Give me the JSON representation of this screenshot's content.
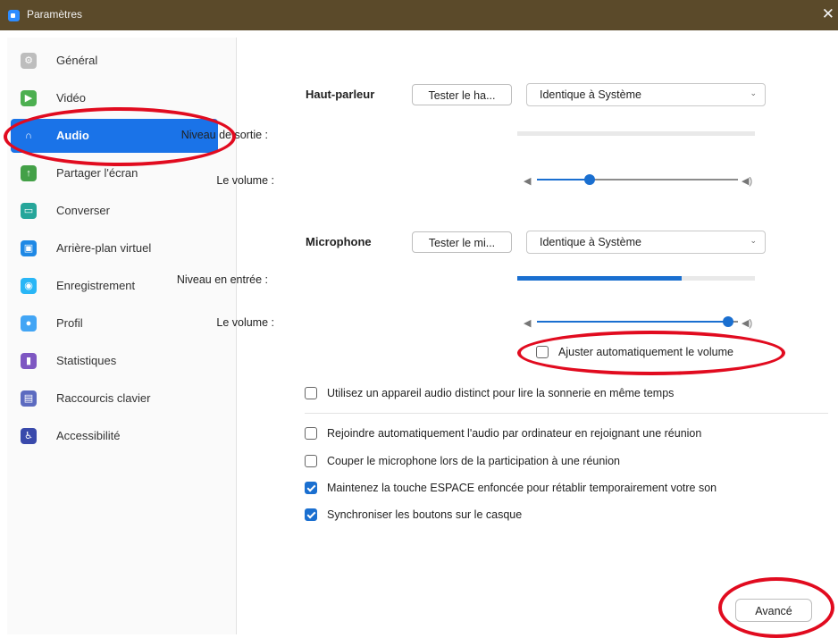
{
  "window": {
    "title": "Paramètres",
    "close_glyph": "✕"
  },
  "sidebar": {
    "items": [
      {
        "label": "Général",
        "icon": "gear-icon",
        "color": "#bdbdbd",
        "glyph": "⚙"
      },
      {
        "label": "Vidéo",
        "icon": "video-camera-icon",
        "color": "#4caf50",
        "glyph": "▶"
      },
      {
        "label": "Audio",
        "icon": "headphones-icon",
        "color": "#1a73e8",
        "glyph": "∩"
      },
      {
        "label": "Partager l'écran",
        "icon": "share-screen-icon",
        "color": "#43a047",
        "glyph": "↑"
      },
      {
        "label": "Converser",
        "icon": "chat-icon",
        "color": "#26a69a",
        "glyph": "▭"
      },
      {
        "label": "Arrière-plan virtuel",
        "icon": "virtual-background-icon",
        "color": "#1e88e5",
        "glyph": "▣"
      },
      {
        "label": "Enregistrement",
        "icon": "record-icon",
        "color": "#29b6f6",
        "glyph": "◉"
      },
      {
        "label": "Profil",
        "icon": "profile-icon",
        "color": "#42a5f5",
        "glyph": "●"
      },
      {
        "label": "Statistiques",
        "icon": "statistics-icon",
        "color": "#7e57c2",
        "glyph": "▮"
      },
      {
        "label": "Raccourcis clavier",
        "icon": "keyboard-icon",
        "color": "#5c6bc0",
        "glyph": "▤"
      },
      {
        "label": "Accessibilité",
        "icon": "accessibility-icon",
        "color": "#3949ab",
        "glyph": "♿"
      }
    ],
    "selected": "Audio"
  },
  "speaker": {
    "label": "Haut-parleur",
    "test_button": "Tester le ha...",
    "device": "Identique à Système",
    "output_level_label": "Niveau de sortie :",
    "output_level": 0,
    "volume_label": "Le volume :",
    "volume": 0.26
  },
  "microphone": {
    "label": "Microphone",
    "test_button": "Tester le mi...",
    "device": "Identique à Système",
    "input_level_label": "Niveau en entrée :",
    "input_level": 0.69,
    "volume_label": "Le volume :",
    "volume": 0.95,
    "auto_adjust_label": "Ajuster automatiquement le volume",
    "auto_adjust": false
  },
  "options": [
    {
      "label": "Utilisez un appareil audio distinct pour lire la sonnerie en même temps",
      "checked": false
    },
    {
      "label": "Rejoindre automatiquement l'audio par ordinateur en rejoignant une réunion",
      "checked": false
    },
    {
      "label": "Couper le microphone lors de la participation à une réunion",
      "checked": false
    },
    {
      "label": "Maintenez la touche ESPACE enfoncée pour rétablir temporairement votre son",
      "checked": true
    },
    {
      "label": "Synchroniser les boutons sur le casque",
      "checked": true
    }
  ],
  "advanced_button": "Avancé",
  "glyphs": {
    "speaker_low": "◀",
    "speaker_high": "◀)",
    "chevron": "⌄"
  },
  "colors": {
    "accent": "#1a73e8",
    "annotation": "#e10b1f",
    "titlebar": "#5b4a2a"
  }
}
